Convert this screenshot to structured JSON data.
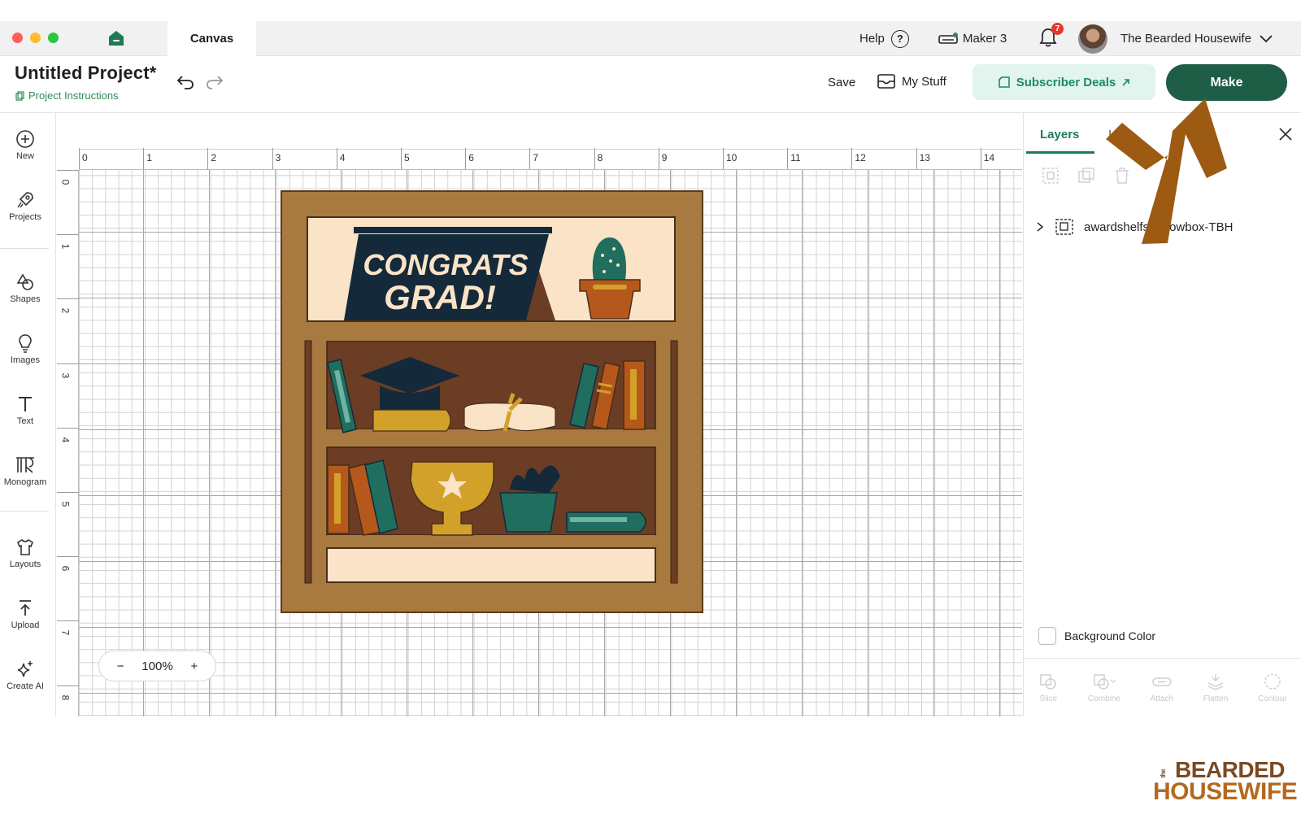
{
  "titlebar": {
    "tab": "Canvas",
    "help": "Help",
    "help_glyph": "?",
    "machine": "Maker 3",
    "notifications": "7",
    "user": "The Bearded Housewife"
  },
  "header": {
    "project_title": "Untitled Project*",
    "project_instructions": "Project Instructions",
    "save": "Save",
    "my_stuff": "My Stuff",
    "subscriber_deals": "Subscriber Deals",
    "make": "Make"
  },
  "left_toolbar": [
    {
      "label": "New",
      "icon": "plus-circle-icon"
    },
    {
      "label": "Projects",
      "icon": "rocket-icon"
    },
    {
      "label": "Shapes",
      "icon": "shapes-icon"
    },
    {
      "label": "Images",
      "icon": "lightbulb-icon"
    },
    {
      "label": "Text",
      "icon": "text-t-icon"
    },
    {
      "label": "Monogram",
      "icon": "monogram-icon"
    },
    {
      "label": "Layouts",
      "icon": "shirt-icon"
    },
    {
      "label": "Upload",
      "icon": "upload-icon"
    },
    {
      "label": "Create AI",
      "icon": "sparkle-icon"
    }
  ],
  "canvas": {
    "ruler_h": [
      "0",
      "1",
      "2",
      "3",
      "4",
      "5",
      "6",
      "7",
      "8",
      "9",
      "10",
      "11",
      "12",
      "13",
      "14"
    ],
    "ruler_v": [
      "0",
      "1",
      "2",
      "3",
      "4",
      "5",
      "6",
      "7",
      "8"
    ],
    "zoom_minus": "−",
    "zoom_level": "100%",
    "zoom_plus": "+",
    "design": {
      "banner_line1": "CONGRATS",
      "banner_line2": "GRAD!",
      "colors": {
        "frame": "#a87a40",
        "panel": "#6b3d24",
        "cream": "#fae3c6",
        "navy": "#14293a",
        "teal": "#1f6e5e",
        "orange": "#b6581b",
        "gold": "#d2a12a"
      }
    }
  },
  "right_panel": {
    "tab_layers": "Layers",
    "tab_other": "I",
    "layer_name": "awardshelfshadowbox-TBH",
    "background_color": "Background Color",
    "bottom_tools": [
      "Slice",
      "Combine",
      "Attach",
      "Flatten",
      "Contour"
    ]
  },
  "overlay": {
    "arrow_color": "#9c5a12"
  },
  "brand": {
    "the": "the",
    "line1": "BEARDED",
    "line2": "HOUSEWIFE"
  }
}
